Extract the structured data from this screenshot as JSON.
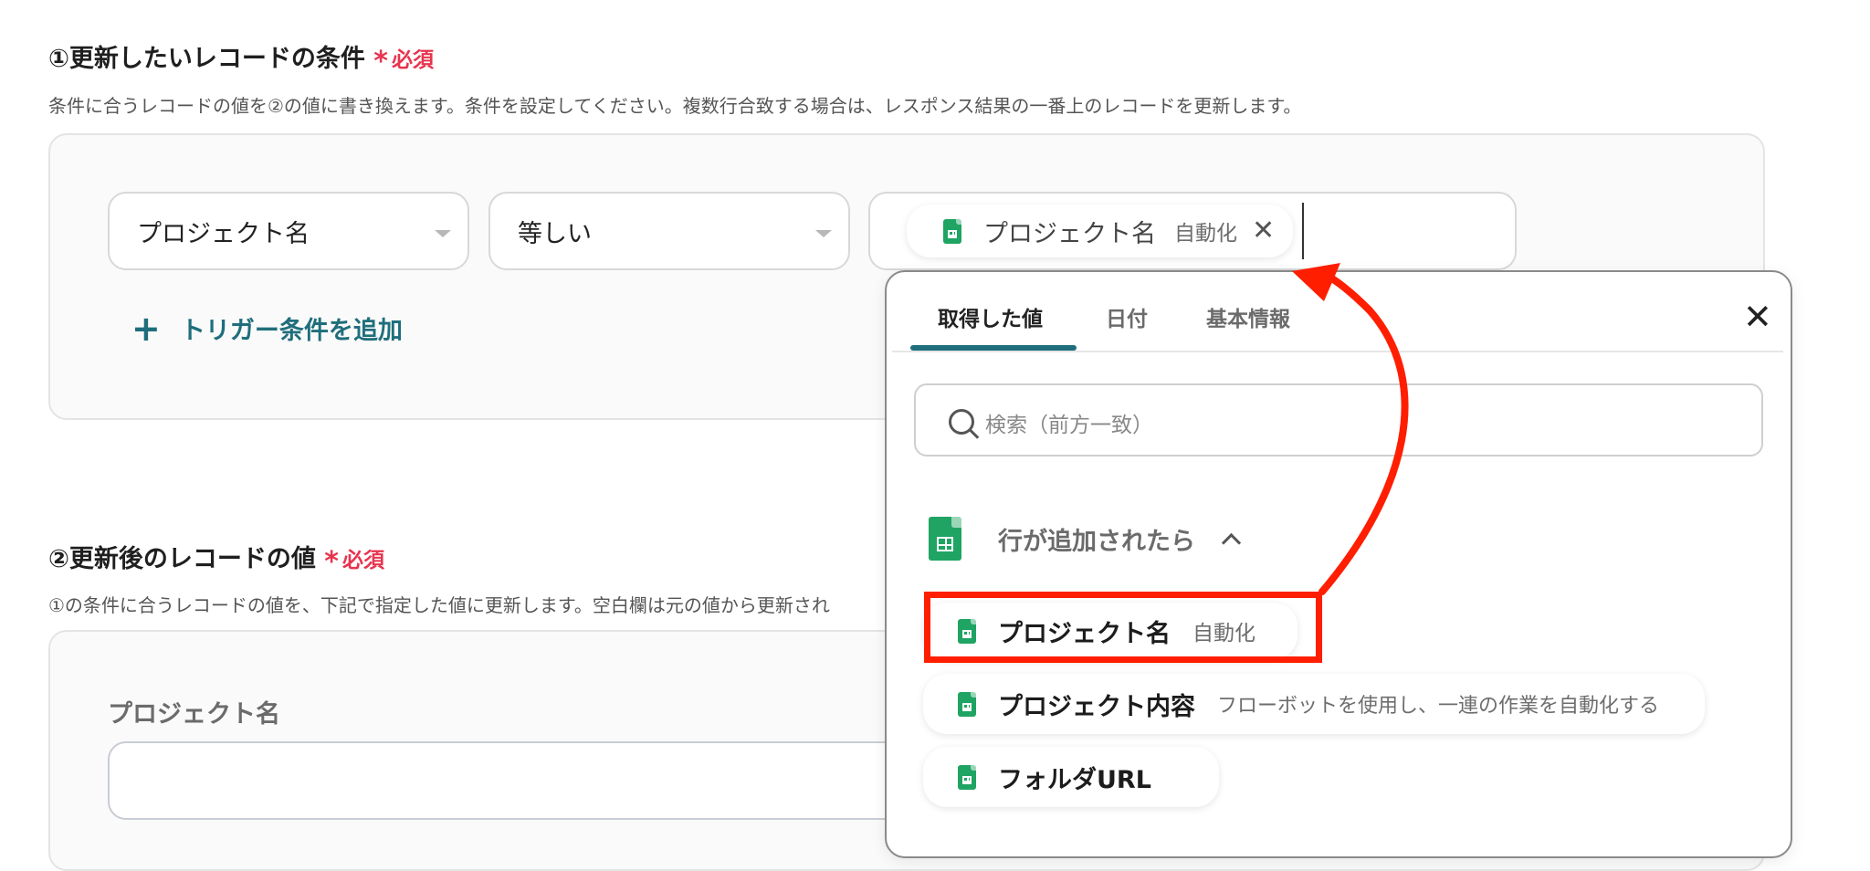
{
  "section1": {
    "title": "①更新したいレコードの条件",
    "required_label": "必須",
    "description": "条件に合うレコードの値を②の値に書き換えます。条件を設定してください。複数行合致する場合は、レスポンス結果の一番上のレコードを更新します。",
    "condition": {
      "field_select": "プロジェクト名",
      "operator_select": "等しい",
      "value_chip": {
        "name": "プロジェクト名",
        "badge": "自動化"
      }
    },
    "add_condition_label": "トリガー条件を追加"
  },
  "section2": {
    "title": "②更新後のレコードの値",
    "required_label": "必須",
    "description": "①の条件に合うレコードの値を、下記で指定した値に更新します。空白欄は元の値から更新され",
    "field_label": "プロジェクト名",
    "field_value": ""
  },
  "dropdown": {
    "tabs": [
      {
        "label": "取得した値",
        "active": true
      },
      {
        "label": "日付",
        "active": false
      },
      {
        "label": "基本情報",
        "active": false
      }
    ],
    "search_placeholder": "検索（前方一致）",
    "group_title": "行が追加されたら",
    "items": [
      {
        "name": "プロジェクト名",
        "sub": "自動化",
        "highlighted": true
      },
      {
        "name": "プロジェクト内容",
        "sub": "フローボットを使用し、一連の作業を自動化する",
        "highlighted": false
      },
      {
        "name": "フォルダURL",
        "sub": "",
        "highlighted": false
      }
    ]
  },
  "colors": {
    "required": "#e8344e",
    "accent_teal": "#1f6e7c",
    "sheets_green": "#1fa463",
    "annotation_red": "#ff1e00"
  },
  "icons": [
    "sheets-icon",
    "close-icon",
    "search-icon",
    "plus-icon",
    "chevron-up-icon",
    "dropdown-caret-icon"
  ]
}
